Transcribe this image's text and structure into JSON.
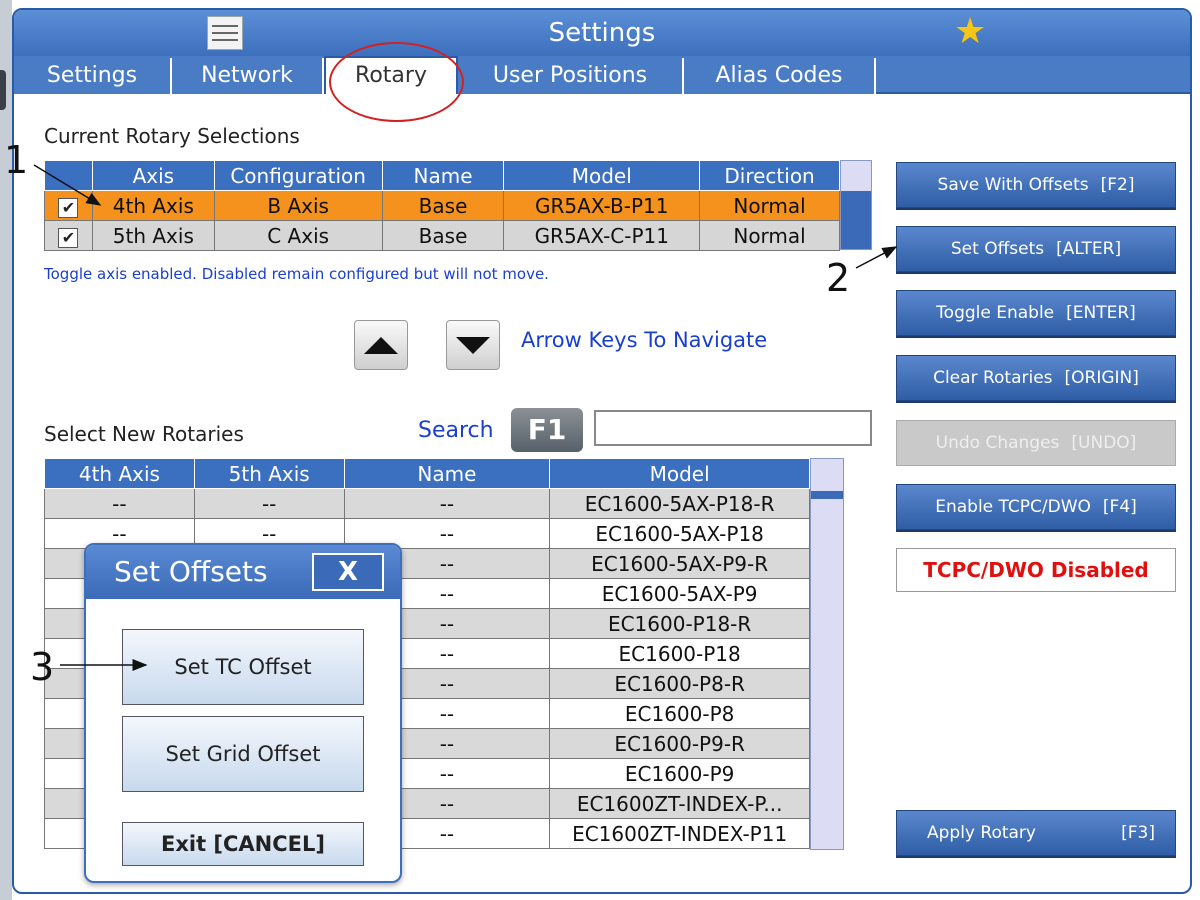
{
  "window": {
    "title": "Settings"
  },
  "tabs": [
    {
      "label": "Settings"
    },
    {
      "label": "Network"
    },
    {
      "label": "Rotary"
    },
    {
      "label": "User Positions"
    },
    {
      "label": "Alias Codes"
    }
  ],
  "current": {
    "heading": "Current Rotary Selections",
    "columns": [
      "",
      "Axis",
      "Configuration",
      "Name",
      "Model",
      "Direction"
    ],
    "rows": [
      {
        "check": "✔",
        "axis": "4th Axis",
        "config": "B Axis",
        "name": "Base",
        "model": "GR5AX-B-P11",
        "direction": "Normal"
      },
      {
        "check": "✔",
        "axis": "5th Axis",
        "config": "C Axis",
        "name": "Base",
        "model": "GR5AX-C-P11",
        "direction": "Normal"
      }
    ],
    "help": "Toggle axis enabled. Disabled remain configured but will not move."
  },
  "nav": {
    "label": "Arrow Keys To Navigate"
  },
  "select_new": {
    "heading": "Select New Rotaries",
    "search_label": "Search",
    "search_key": "F1",
    "search_value": "",
    "columns": [
      "4th Axis",
      "5th Axis",
      "Name",
      "Model"
    ],
    "rows": [
      {
        "a4": "--",
        "a5": "--",
        "name": "--",
        "model": "EC1600-5AX-P18-R"
      },
      {
        "a4": "--",
        "a5": "--",
        "name": "--",
        "model": "EC1600-5AX-P18"
      },
      {
        "a4": "",
        "a5": "",
        "name": "--",
        "model": "EC1600-5AX-P9-R"
      },
      {
        "a4": "",
        "a5": "",
        "name": "--",
        "model": "EC1600-5AX-P9"
      },
      {
        "a4": "",
        "a5": "",
        "name": "--",
        "model": "EC1600-P18-R"
      },
      {
        "a4": "",
        "a5": "",
        "name": "--",
        "model": "EC1600-P18"
      },
      {
        "a4": "",
        "a5": "",
        "name": "--",
        "model": "EC1600-P8-R"
      },
      {
        "a4": "",
        "a5": "",
        "name": "--",
        "model": "EC1600-P8"
      },
      {
        "a4": "",
        "a5": "",
        "name": "--",
        "model": "EC1600-P9-R"
      },
      {
        "a4": "",
        "a5": "",
        "name": "--",
        "model": "EC1600-P9"
      },
      {
        "a4": "",
        "a5": "",
        "name": "--",
        "model": "EC1600ZT-INDEX-P..."
      },
      {
        "a4": "",
        "a5": "",
        "name": "--",
        "model": "EC1600ZT-INDEX-P11"
      }
    ]
  },
  "side_buttons": [
    {
      "label": "Save With Offsets",
      "key": "[F2]",
      "disabled": false
    },
    {
      "label": "Set Offsets",
      "key": "[ALTER]",
      "disabled": false
    },
    {
      "label": "Toggle Enable",
      "key": "[ENTER]",
      "disabled": false
    },
    {
      "label": "Clear Rotaries",
      "key": "[ORIGIN]",
      "disabled": false
    },
    {
      "label": "Undo Changes",
      "key": "[UNDO]",
      "disabled": true
    },
    {
      "label": "Enable TCPC/DWO",
      "key": "[F4]",
      "disabled": false
    }
  ],
  "status": {
    "tcpc": "TCPC/DWO Disabled"
  },
  "apply": {
    "label": "Apply Rotary",
    "key": "[F3]"
  },
  "dialog": {
    "title": "Set Offsets",
    "close": "X",
    "btn_tc": "Set TC Offset",
    "btn_grid": "Set Grid Offset",
    "btn_exit": "Exit  [CANCEL]"
  },
  "callouts": {
    "c1": "1",
    "c2": "2",
    "c3": "3"
  },
  "colors": {
    "title_blue": "#3d6fbd",
    "selected_row": "#f5921e",
    "status_red": "#e01010",
    "star": "#f3c61a",
    "annotation_circle": "#d32020"
  },
  "icons": [
    "menu-icon",
    "star-icon",
    "arrow-up-icon",
    "arrow-down-icon",
    "checkbox-icon",
    "close-icon"
  ]
}
